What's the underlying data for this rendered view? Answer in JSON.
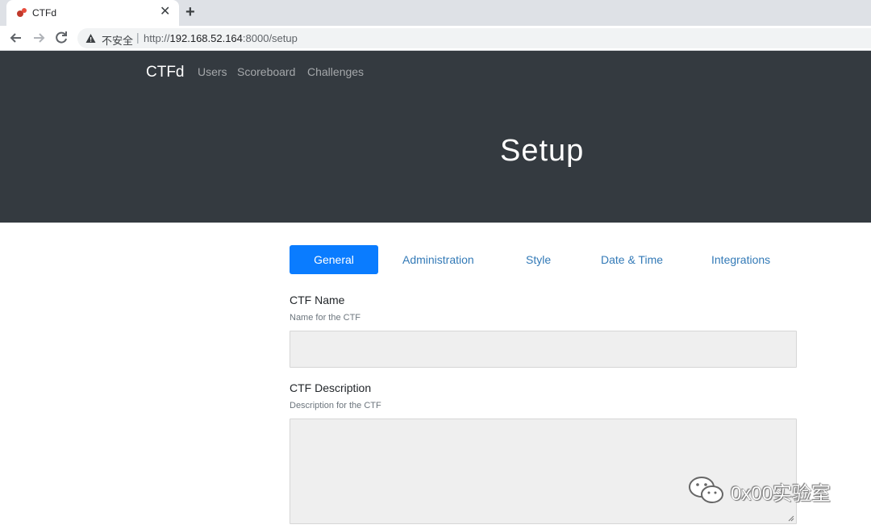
{
  "browser": {
    "tab_title": "CTFd",
    "tab_close": "✕",
    "new_tab": "+",
    "security_label": "不安全",
    "separator": "|",
    "url_scheme": "http://",
    "url_host": "192.168.52.164",
    "url_rest": ":8000/setup"
  },
  "navbar": {
    "brand": "CTFd",
    "links": [
      "Users",
      "Scoreboard",
      "Challenges"
    ]
  },
  "page": {
    "title": "Setup"
  },
  "tabs": [
    {
      "label": "General",
      "active": true
    },
    {
      "label": "Administration",
      "active": false
    },
    {
      "label": "Style",
      "active": false
    },
    {
      "label": "Date & Time",
      "active": false
    },
    {
      "label": "Integrations",
      "active": false
    }
  ],
  "form": {
    "ctf_name": {
      "label": "CTF Name",
      "help": "Name for the CTF",
      "value": ""
    },
    "ctf_description": {
      "label": "CTF Description",
      "help": "Description for the CTF",
      "value": ""
    }
  },
  "watermark": {
    "text": "0x00实验室"
  },
  "colors": {
    "header_bg": "#343a40",
    "accent": "#0a7cff",
    "link": "#337ab7"
  }
}
